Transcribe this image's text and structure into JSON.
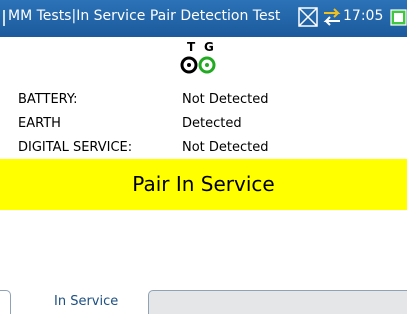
{
  "titlebar": {
    "title": "MM Tests|In Service Pair Detection Test",
    "time": "17:05",
    "icons": [
      "screen-capture-icon",
      "connection-arrows-icon",
      "battery-icon"
    ],
    "color": "#1f5fa2"
  },
  "leads": {
    "tip_label": "T",
    "ring_label": "G",
    "tip_color": "#000000",
    "ring_color": "#22aa22"
  },
  "results": [
    {
      "label": "BATTERY:",
      "value": "Not Detected"
    },
    {
      "label": "EARTH",
      "value": "Detected"
    },
    {
      "label": "DIGITAL SERVICE:",
      "value": "Not Detected"
    }
  ],
  "banner": {
    "text": "Pair In Service",
    "color": "#ffff00"
  },
  "tabs": {
    "active_label": "In Service"
  }
}
